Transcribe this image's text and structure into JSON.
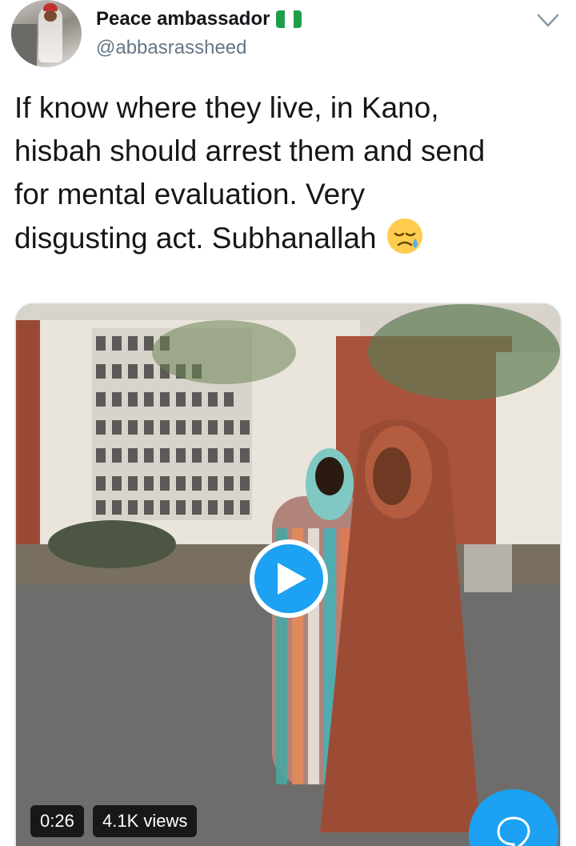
{
  "tweet": {
    "author": {
      "display_name": "Peace ambassador",
      "flag": "Nigeria flag",
      "handle": "@abbasrassheed"
    },
    "text": "If know where they live, in Kano,\nhisbah should arrest them and send\nfor mental evaluation. Very\ndisgusting act. Subhanallah ",
    "emoji": "sad-tear face",
    "media": {
      "type": "video",
      "duration": "0:26",
      "views": "4.1K views"
    }
  },
  "colors": {
    "accent": "#1da1f2",
    "text": "#14171a",
    "secondary_text": "#657786",
    "flag_green": "#1f9e4a"
  },
  "icons": [
    "chevron-down-icon",
    "play-icon",
    "compose-reply-icon"
  ]
}
